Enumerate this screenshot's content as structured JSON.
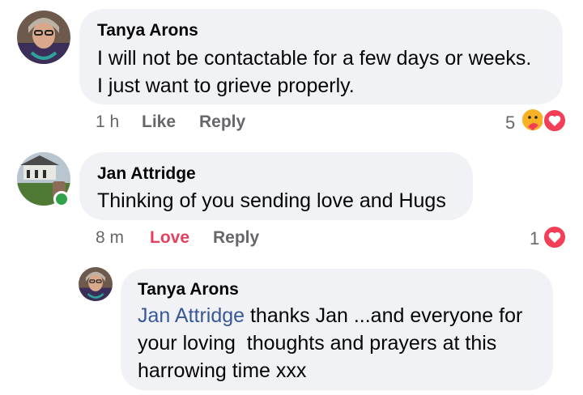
{
  "comments": [
    {
      "author": "Tanya Arons",
      "lines": [
        "I will not be contactable for a few days or weeks.",
        "I just want to grieve properly."
      ],
      "time": "1 h",
      "action1": "Like",
      "action2": "Reply",
      "reaction_count": "5"
    },
    {
      "author": "Jan Attridge",
      "lines": [
        "Thinking of you sending love and Hugs"
      ],
      "time": "8 m",
      "action1": "Love",
      "action2": "Reply",
      "reaction_count": "1"
    }
  ],
  "reply": {
    "author": "Tanya Arons",
    "mention": "Jan Attridge",
    "line1_rest": " thanks Jan ...and everyone for",
    "line2": "your loving  thoughts and prayers at this",
    "line3": "harrowing time xxx"
  },
  "colors": {
    "bubble": "#f0f2f5",
    "love": "#e4405f",
    "mention": "#385898",
    "online": "#31a24c",
    "meta": "#65676b"
  },
  "icons": [
    "avatar",
    "care-reaction-icon",
    "love-reaction-icon",
    "online-indicator"
  ]
}
